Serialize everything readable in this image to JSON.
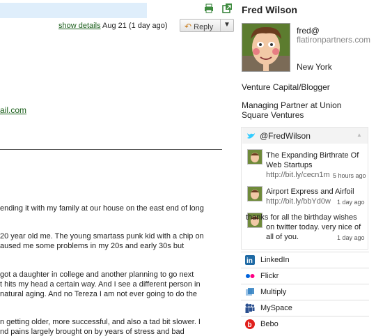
{
  "email": {
    "show_details": "show details",
    "date": "Aug 21 (1 day ago)",
    "reply_label": "Reply",
    "reply_dropdown": "▼",
    "address_fragment": "ail.com",
    "body_lines": [
      "ending it with my family at our house on the east end of long",
      "20 year old me. The young smartass punk kid with a chip on",
      "aused me some problems in my 20s and early 30s but",
      "got a daughter in college and another planning to go next",
      "t hits my head a certain way. And I see a different person in",
      "natural aging. And no Tereza I am not ever going to do the",
      "n getting older, more successful, and also a tad bit slower. I",
      "nd pains largely brought on by years of stress and bad"
    ]
  },
  "profile": {
    "name": "Fred Wilson",
    "email_user": "fred@",
    "email_domain": "flatironpartners.com",
    "location": "New York",
    "tagline1": "Venture Capital/Blogger",
    "tagline2": "Managing Partner at Union Square Ventures"
  },
  "twitter": {
    "handle": "@FredWilson",
    "tweets": [
      {
        "text": "The Expanding Birthrate Of Web Startups",
        "link": "http://bit.ly/cecn1m",
        "time": "5 hours ago"
      },
      {
        "text": "Airport Express and Airfoil",
        "link": "http://bit.ly/bbYd0w",
        "time": "1 day ago"
      },
      {
        "text": "thanks for all the birthday wishes on twitter today. very nice of all of you.",
        "link": "",
        "time": "1 day ago"
      }
    ]
  },
  "services": [
    {
      "label": "LinkedIn",
      "icon": "linkedin-icon",
      "color": "#1f6aa5"
    },
    {
      "label": "Flickr",
      "icon": "flickr-icon",
      "color": "#ff0084"
    },
    {
      "label": "Multiply",
      "icon": "multiply-icon",
      "color": "#2f7fc1"
    },
    {
      "label": "MySpace",
      "icon": "myspace-icon",
      "color": "#2a4f8f"
    },
    {
      "label": "Bebo",
      "icon": "bebo-icon",
      "color": "#e0201c"
    }
  ],
  "colors": {
    "link_green": "#1a5e1a",
    "twitter_blue": "#33ccff"
  }
}
